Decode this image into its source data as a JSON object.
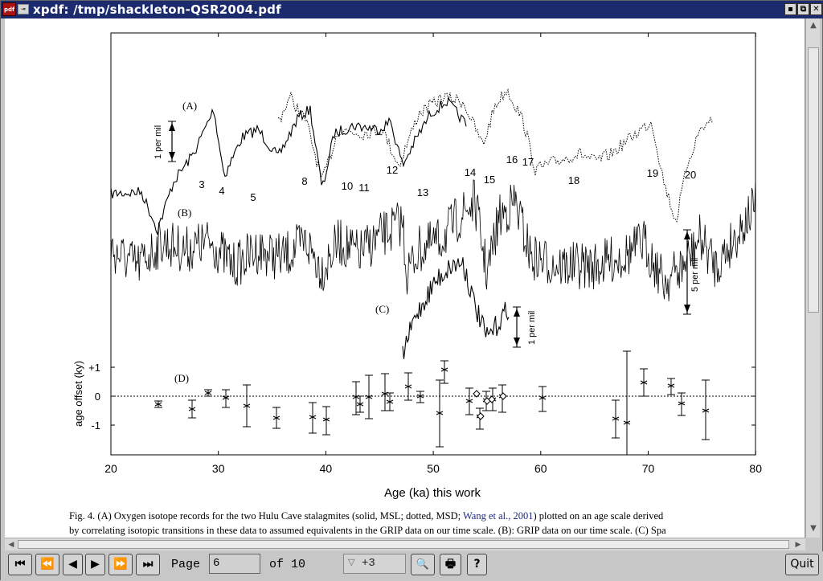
{
  "window": {
    "app_icon": "pdf",
    "title": "xpdf: /tmp/shackleton-QSR2004.pdf",
    "controls": {
      "minimize": "▪",
      "maximize": "⧉",
      "close": "✕"
    }
  },
  "figure": {
    "series_labels": {
      "a": "(A)",
      "b": "(B)",
      "c": "(C)",
      "d": "(D)"
    },
    "scale_bars": {
      "a": "1 per mil",
      "b": "5 per mil",
      "c": "1 per mil"
    },
    "event_numbers": [
      "3",
      "4",
      "5",
      "8",
      "10",
      "11",
      "12",
      "13",
      "14",
      "15",
      "16",
      "17",
      "18",
      "19",
      "20"
    ],
    "d_ylabel": "age offset (ky)",
    "d_yticks": [
      "+1",
      "0",
      "-1"
    ],
    "xticks": [
      "20",
      "30",
      "40",
      "50",
      "60",
      "70",
      "80"
    ],
    "xlabel": "Age (ka) this work"
  },
  "caption": {
    "line1_pre": "Fig. 4.  (A) Oxygen isotope records for the two Hulu Cave stalagmites (solid, MSL; dotted, MSD; ",
    "line1_link": "Wang et al., 2001",
    "line1_post": ") plotted on an age scale derived",
    "line2": "by correlating isotopic transitions in these data to assumed equivalents in the GRIP data on our time scale. (B): GRIP data on our time scale. (C) Spa"
  },
  "toolbar": {
    "first_page": "⏮",
    "prev_10": "⏪",
    "prev": "◀",
    "next": "▶",
    "next_10": "⏩",
    "last_page": "⏭",
    "page_label": "Page",
    "page_value": "6",
    "of_label": "of 10",
    "zoom_value": "+3",
    "find": "🔍",
    "print": "🖶",
    "help": "?",
    "quit": "Quit"
  }
}
